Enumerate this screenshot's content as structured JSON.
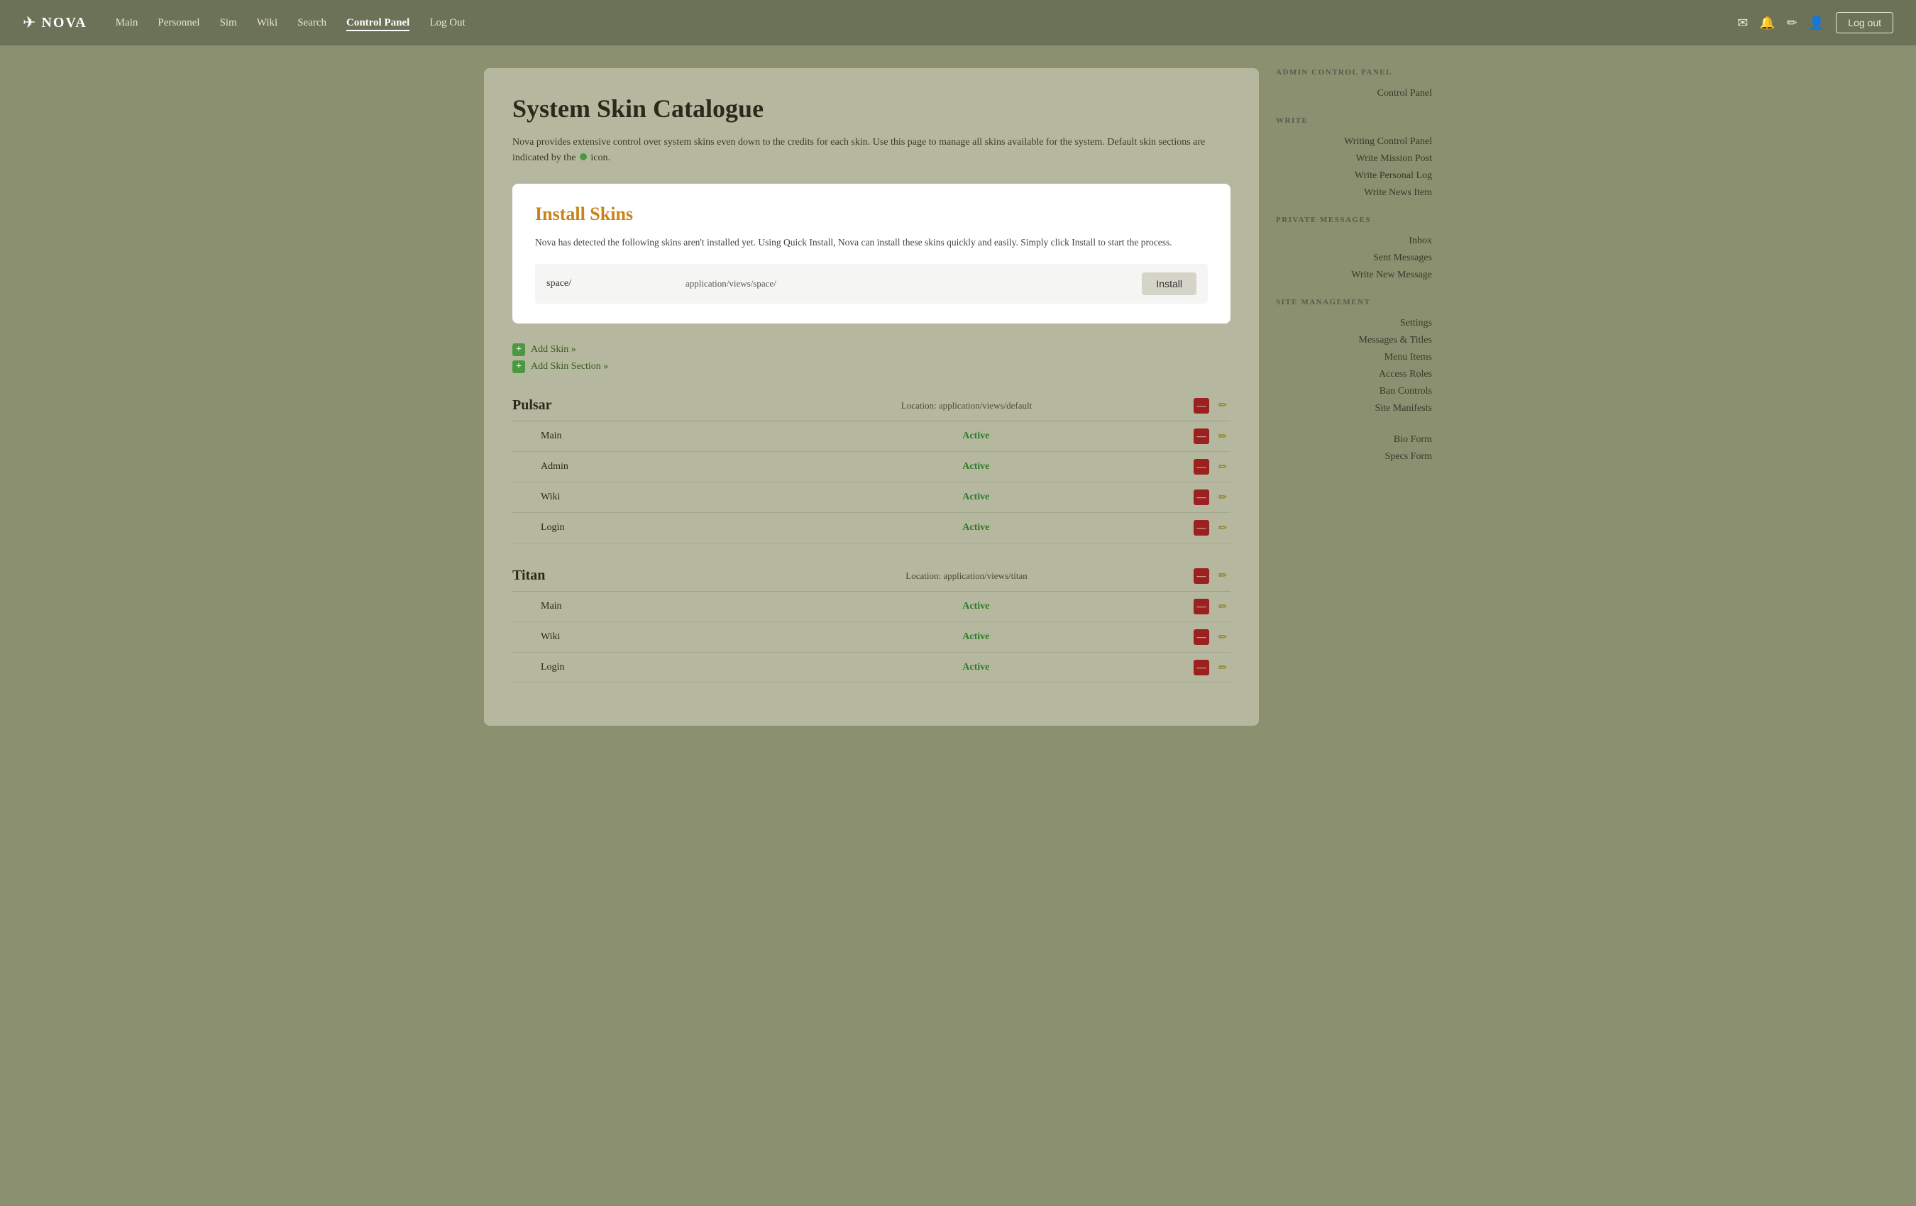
{
  "nav": {
    "logo_text": "NOVA",
    "links": [
      {
        "label": "Main",
        "active": false
      },
      {
        "label": "Personnel",
        "active": false
      },
      {
        "label": "Sim",
        "active": false
      },
      {
        "label": "Wiki",
        "active": false
      },
      {
        "label": "Search",
        "active": false
      },
      {
        "label": "Control Panel",
        "active": true
      },
      {
        "label": "Log Out",
        "active": false
      }
    ],
    "logout_label": "Log out"
  },
  "page": {
    "title": "System Skin Catalogue",
    "description": "Nova provides extensive control over system skins even down to the credits for each skin. Use this page to manage all skins available for the system. Default skin sections are indicated by the",
    "description_end": "icon."
  },
  "install_panel": {
    "title": "Install Skins",
    "description": "Nova has detected the following skins aren't installed yet. Using Quick Install, Nova can install these skins quickly and easily. Simply click Install to start the process.",
    "skin_name": "space/",
    "skin_path": "application/views/space/",
    "install_button": "Install"
  },
  "actions": {
    "add_skin": "Add Skin »",
    "add_skin_section": "Add Skin Section »"
  },
  "skin_groups": [
    {
      "name": "Pulsar",
      "location": "Location: application/views/default",
      "skins": [
        {
          "name": "Main",
          "status": "Active"
        },
        {
          "name": "Admin",
          "status": "Active"
        },
        {
          "name": "Wiki",
          "status": "Active"
        },
        {
          "name": "Login",
          "status": "Active"
        }
      ]
    },
    {
      "name": "Titan",
      "location": "Location: application/views/titan",
      "skins": [
        {
          "name": "Main",
          "status": "Active"
        },
        {
          "name": "Wiki",
          "status": "Active"
        },
        {
          "name": "Login",
          "status": "Active"
        }
      ]
    }
  ],
  "sidebar": {
    "sections": [
      {
        "title": "ADMIN CONTROL PANEL",
        "items": [
          {
            "label": "Control Panel"
          }
        ]
      },
      {
        "title": "WRITE",
        "items": [
          {
            "label": "Writing Control Panel"
          },
          {
            "label": "Write Mission Post"
          },
          {
            "label": "Write Personal Log"
          },
          {
            "label": "Write News Item"
          }
        ]
      },
      {
        "title": "PRIVATE MESSAGES",
        "items": [
          {
            "label": "Inbox"
          },
          {
            "label": "Sent Messages"
          },
          {
            "label": "Write New Message"
          }
        ]
      },
      {
        "title": "SITE MANAGEMENT",
        "items": [
          {
            "label": "Settings"
          },
          {
            "label": "Messages & Titles"
          },
          {
            "label": "Menu Items"
          },
          {
            "label": "Access Roles"
          },
          {
            "label": "Ban Controls"
          },
          {
            "label": "Site Manifests"
          }
        ]
      },
      {
        "title": "",
        "items": [
          {
            "label": "Bio Form"
          },
          {
            "label": "Specs Form"
          }
        ]
      }
    ]
  }
}
